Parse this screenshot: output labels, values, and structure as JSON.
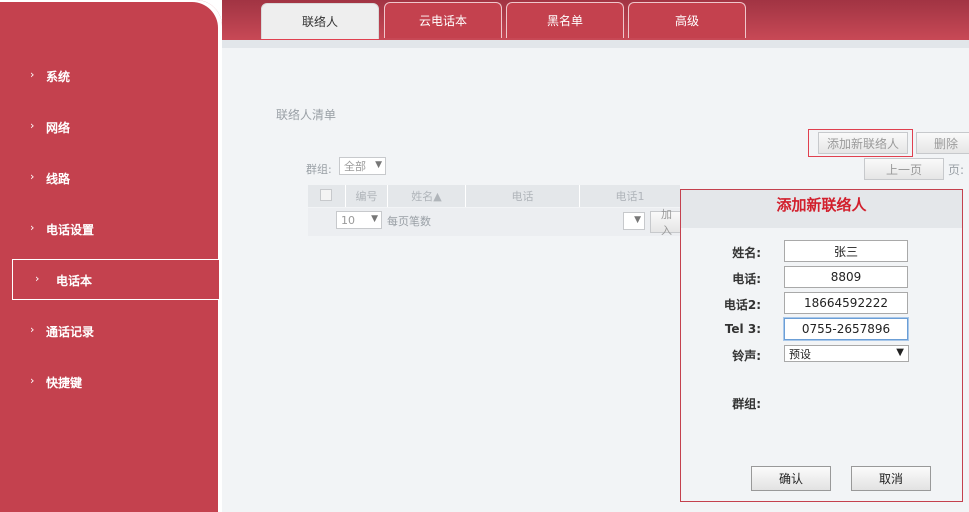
{
  "sidebar": {
    "items": [
      {
        "label": "系统"
      },
      {
        "label": "网络"
      },
      {
        "label": "线路"
      },
      {
        "label": "电话设置"
      },
      {
        "label": "电话本"
      },
      {
        "label": "通话记录"
      },
      {
        "label": "快捷键"
      }
    ],
    "chevron": "›"
  },
  "tabs": [
    {
      "label": "联络人"
    },
    {
      "label": "云电话本"
    },
    {
      "label": "黑名单"
    },
    {
      "label": "高级"
    }
  ],
  "main": {
    "section_title": "联络人清单",
    "add_button": "添加新联络人",
    "delete_button": "删除",
    "prev_button": "上一页",
    "page_label": "页:",
    "group_label": "群组:",
    "group_value": "全部",
    "table_headers": [
      "编号",
      "姓名▲",
      "电话",
      "电话1"
    ],
    "per_page_value": "10",
    "per_page_label": "每页笔数",
    "join_button": "加入"
  },
  "dialog": {
    "title": "添加新联络人",
    "name_label": "姓名:",
    "name_value": "张三",
    "phone_label": "电话:",
    "phone_value": "8809",
    "phone2_label": "电话2:",
    "phone2_value": "18664592222",
    "tel3_label": "Tel 3:",
    "tel3_value": "0755-2657896",
    "ring_label": "铃声:",
    "ring_value": "预设",
    "group_label": "群组:",
    "confirm_button": "确认",
    "cancel_button": "取消"
  },
  "colors": {
    "brand": "#c4414e",
    "dialog_title": "#d21f2c",
    "highlight": "#e0404f"
  }
}
